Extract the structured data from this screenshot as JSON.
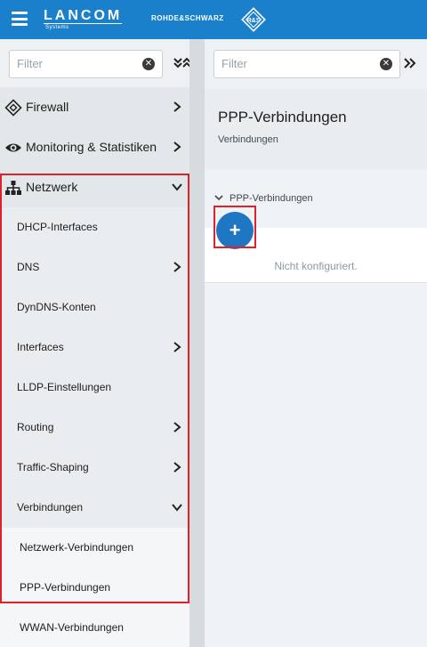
{
  "header": {
    "brand": "LANCOM",
    "brand_sub": "Systems",
    "partner": "ROHDE&SCHWARZ",
    "rs_emblem": "R&S"
  },
  "sidebar": {
    "filter_placeholder": "Filter",
    "items": [
      {
        "label": "Firewall",
        "icon": "firewall-icon",
        "chevron": "right"
      },
      {
        "label": "Monitoring & Statistiken",
        "icon": "eye-icon",
        "chevron": "right"
      },
      {
        "label": "Netzwerk",
        "icon": "network-icon",
        "chevron": "down"
      }
    ],
    "subitems": [
      {
        "label": "DHCP-Interfaces",
        "chevron": ""
      },
      {
        "label": "DNS",
        "chevron": "right"
      },
      {
        "label": "DynDNS-Konten",
        "chevron": ""
      },
      {
        "label": "Interfaces",
        "chevron": "right"
      },
      {
        "label": "LLDP-Einstellungen",
        "chevron": ""
      },
      {
        "label": "Routing",
        "chevron": "right"
      },
      {
        "label": "Traffic-Shaping",
        "chevron": "right"
      },
      {
        "label": "Verbindungen",
        "chevron": "down"
      }
    ],
    "sub2items": [
      {
        "label": "Netzwerk-Verbindungen"
      },
      {
        "label": "PPP-Verbindungen"
      },
      {
        "label": "WWAN-Verbindungen"
      }
    ]
  },
  "main": {
    "filter_placeholder": "Filter",
    "title": "PPP-Verbindungen",
    "subtitle": "Verbindungen",
    "section_label": "PPP-Verbindungen",
    "empty_text": "Nicht konfiguriert.",
    "add_label": "+"
  },
  "colors": {
    "header_bg": "#1a80cc",
    "add_button": "#1f76c2",
    "highlight": "#e0202a"
  }
}
